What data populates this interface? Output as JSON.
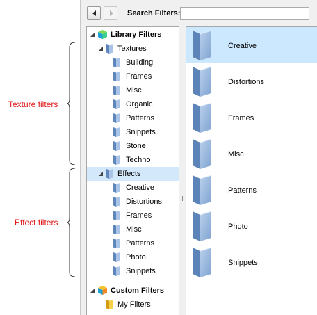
{
  "annotations": {
    "texture_filters": "Texture filters",
    "effect_filters": "Effect filters"
  },
  "colors": {
    "annotation_red": "#e0191b",
    "selection": "#cce8ff",
    "folder_blue": "#8fb0d8"
  },
  "toolbar": {
    "back_icon": "back-arrow-icon",
    "forward_icon": "forward-arrow-icon",
    "search_label": "Search Filters:",
    "search_value": ""
  },
  "tree": {
    "library_label": "Library Filters",
    "textures": {
      "label": "Textures",
      "items": [
        "Building",
        "Frames",
        "Misc",
        "Organic",
        "Patterns",
        "Snippets",
        "Stone",
        "Techno"
      ]
    },
    "effects": {
      "label": "Effects",
      "selected": true,
      "items": [
        "Creative",
        "Distortions",
        "Frames",
        "Misc",
        "Patterns",
        "Photo",
        "Snippets"
      ]
    },
    "custom_label": "Custom Filters",
    "my_filters_label": "My Filters"
  },
  "list": {
    "selected_index": 0,
    "items": [
      "Creative",
      "Distortions",
      "Frames",
      "Misc",
      "Patterns",
      "Photo",
      "Snippets"
    ]
  }
}
